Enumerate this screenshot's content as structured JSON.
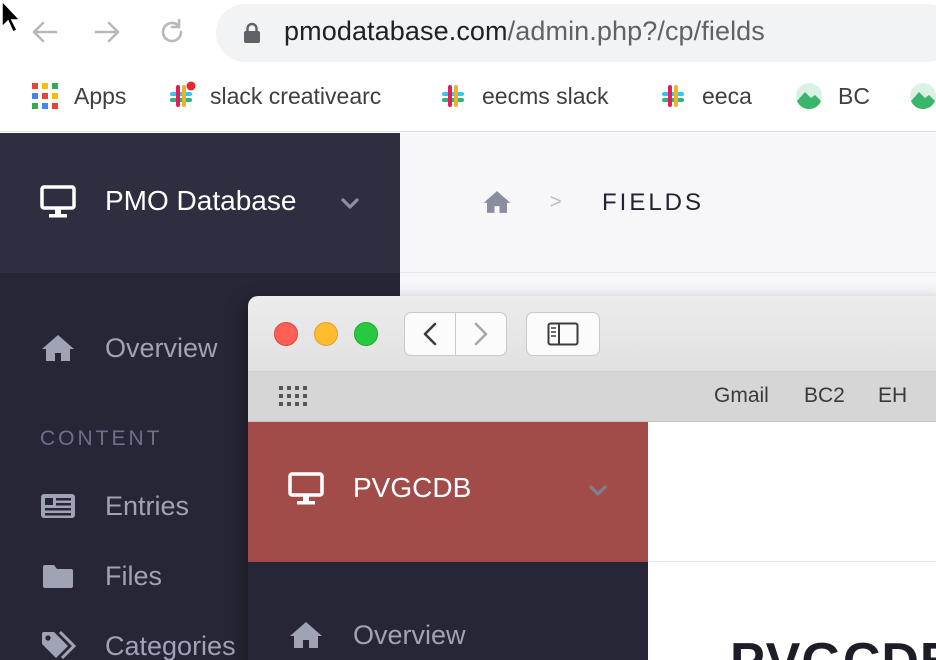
{
  "browser": {
    "url_domain": "pmodatabase.com",
    "url_path": "/admin.php?/cp/fields",
    "bookmarks": [
      {
        "label": "Apps",
        "icon": "apps-grid-icon"
      },
      {
        "label": "slack creativearc",
        "icon": "slack-icon"
      },
      {
        "label": "eecms slack",
        "icon": "slack-icon"
      },
      {
        "label": "eeca",
        "icon": "slack-icon"
      },
      {
        "label": "BC",
        "icon": "basecamp-icon"
      }
    ]
  },
  "back_app": {
    "site_name": "PMO Database",
    "nav": [
      {
        "label": "Overview",
        "icon": "home-icon"
      },
      {
        "label": "Entries",
        "icon": "entries-icon"
      },
      {
        "label": "Files",
        "icon": "folder-icon"
      },
      {
        "label": "Categories",
        "icon": "tags-icon"
      }
    ],
    "section_label": "CONTENT",
    "breadcrumb_current": "FIELDS"
  },
  "safari": {
    "favorites": [
      "Gmail",
      "BC2",
      "EH"
    ],
    "site_name": "PVGCDB",
    "nav": [
      {
        "label": "Overview",
        "icon": "home-icon"
      }
    ],
    "page_heading": "PVGCDB"
  },
  "colors": {
    "sidebar_dark": "#262637",
    "sidebar_header_dark": "#2d2e3f",
    "site_header_red": "#a24c4a"
  }
}
